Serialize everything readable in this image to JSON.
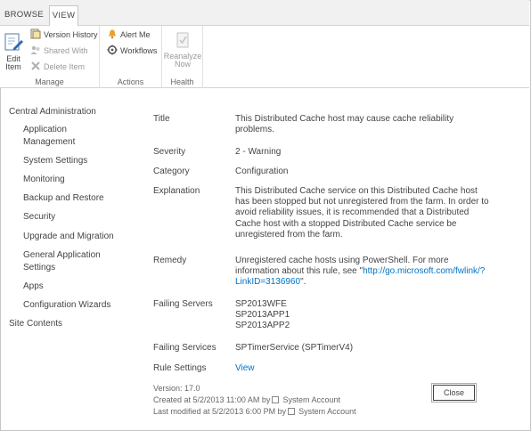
{
  "ribbon": {
    "tabs": [
      "BROWSE",
      "VIEW"
    ],
    "manage": {
      "edit_item": "Edit Item",
      "version_history": "Version History",
      "shared_with": "Shared With",
      "delete_item": "Delete Item",
      "group_label": "Manage"
    },
    "actions": {
      "alert_me": "Alert Me",
      "workflows": "Workflows",
      "group_label": "Actions"
    },
    "health": {
      "reanalyze_now_line1": "Reanalyze",
      "reanalyze_now_line2": "Now",
      "group_label": "Health"
    }
  },
  "nav": {
    "items": [
      "Central Administration",
      "Application",
      "Management",
      "System Settings",
      "Monitoring",
      "Backup and Restore",
      "Security",
      "Upgrade and Migration",
      "General Application",
      "Settings",
      "Apps",
      "Configuration Wizards",
      "Site Contents"
    ]
  },
  "details": {
    "title_label": "Title",
    "title_value": "This Distributed Cache host may cause cache reliability problems.",
    "severity_label": "Severity",
    "severity_value": "2 - Warning",
    "category_label": "Category",
    "category_value": "Configuration",
    "explanation_label": "Explanation",
    "explanation_value": "This Distributed Cache service on this Distributed Cache host has been stopped but not unregistered from the farm. In order to avoid reliability issues, it is recommended that a Distributed Cache host with a stopped Distributed Cache service be unregistered from the farm.",
    "remedy_label": "Remedy",
    "remedy_text": "Unregistered cache hosts using PowerShell. For more information about this rule, see",
    "remedy_quote_open": "\"",
    "remedy_link": "http://go.microsoft.com/fwlink/?LinkID=3136960",
    "remedy_quote_close": "\".",
    "failing_servers_label": "Failing Servers",
    "failing_servers": [
      "SP2013WFE",
      "SP2013APP1",
      "SP2013APP2"
    ],
    "failing_services_label": "Failing Services",
    "failing_services_value": "SPTimerService (SPTimerV4)",
    "rule_settings_label": "Rule Settings",
    "rule_settings_link": "View"
  },
  "footer": {
    "version": "Version: 17.0",
    "created": "Created at 5/2/2013 11:00 AM  by",
    "created_by": "System Account",
    "modified": "Last modified at 5/2/2013 6:00 PM  by",
    "modified_by": "System Account"
  },
  "close_label": "Close"
}
